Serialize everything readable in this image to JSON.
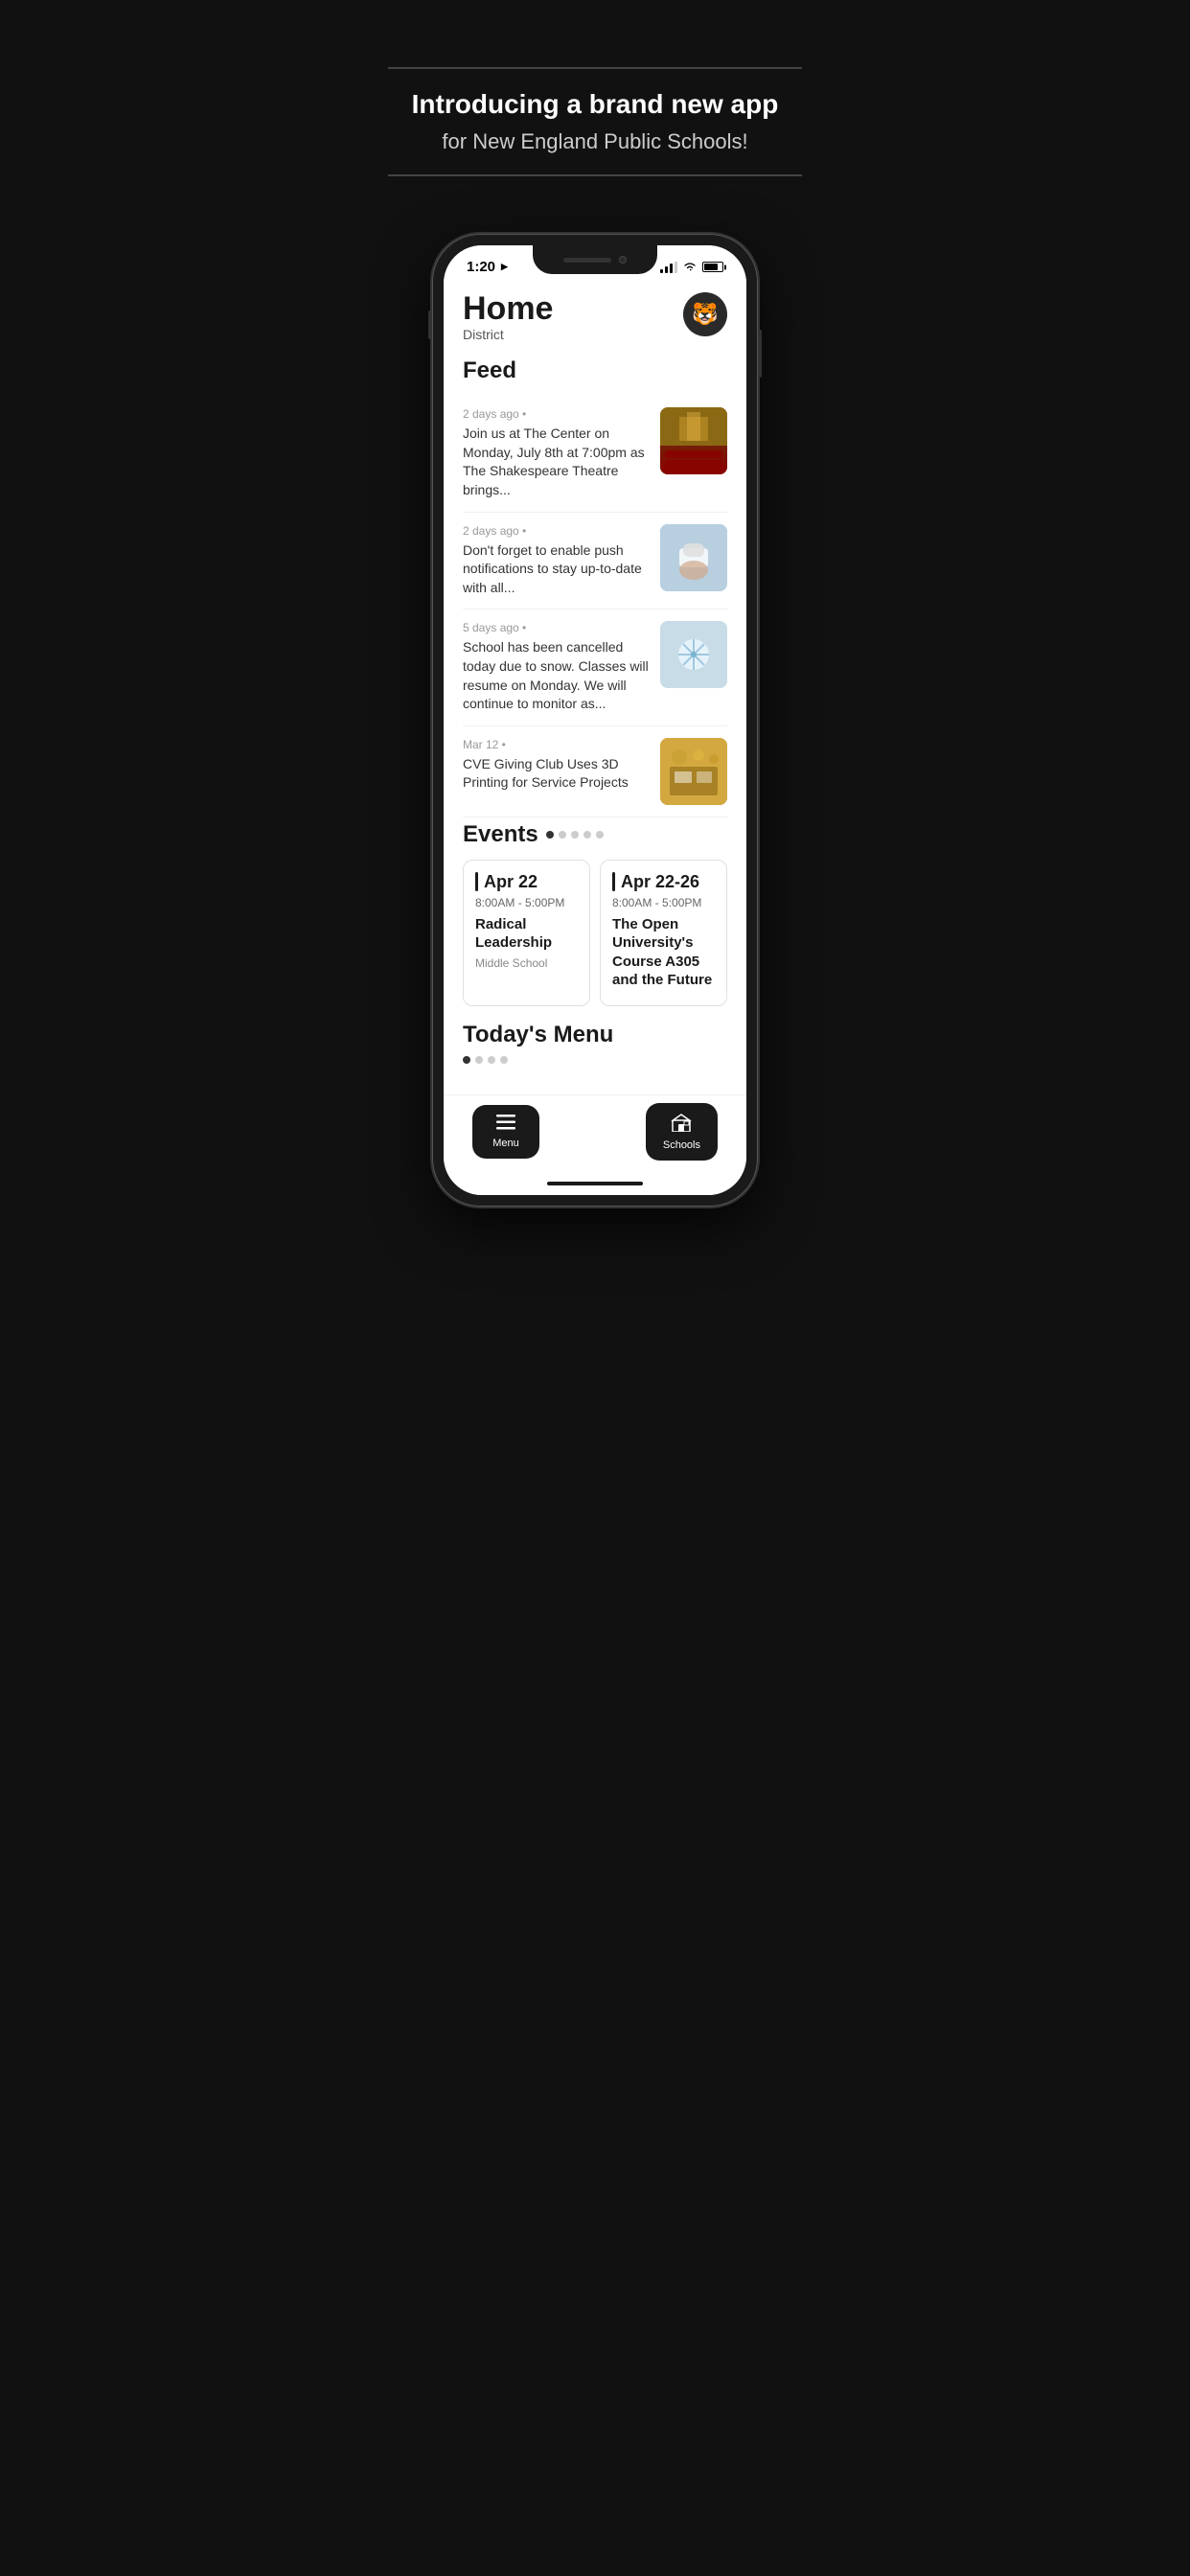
{
  "promo": {
    "divider_top": "",
    "title": "Introducing a brand new app",
    "subtitle": "for New England Public Schools!",
    "divider_bottom": ""
  },
  "statusBar": {
    "time": "1:20",
    "timeArrow": "➤"
  },
  "header": {
    "title": "Home",
    "subtitle": "District",
    "avatar": "🐯"
  },
  "feed": {
    "sectionTitle": "Feed",
    "items": [
      {
        "meta": "2 days ago • ",
        "desc": "Join us at The Center on Monday, July 8th at 7:00pm as The Shakespeare Theatre brings...",
        "thumbType": "theater"
      },
      {
        "meta": "2 days ago • ",
        "desc": "Don't forget to enable push notifications to stay up-to-date with all...",
        "thumbType": "phone"
      },
      {
        "meta": "5 days ago • ",
        "desc": "School has been cancelled today due to snow. Classes will resume on Monday. We will continue to monitor as...",
        "thumbType": "snow"
      },
      {
        "meta": "Mar 12 • ",
        "desc": "CVE Giving Club Uses 3D Printing for Service Projects",
        "thumbType": "3d"
      }
    ]
  },
  "events": {
    "sectionTitle": "Events",
    "dots": [
      {
        "active": true
      },
      {
        "active": false
      },
      {
        "active": false
      },
      {
        "active": false
      },
      {
        "active": false
      }
    ],
    "cards": [
      {
        "date": "Apr 22",
        "time": "8:00AM  -  5:00PM",
        "name": "Radical Leadership",
        "location": "Middle School"
      },
      {
        "date": "Apr 22-26",
        "time": "8:00AM  -  5:00PM",
        "name": "The Open University's Course A305 and the Future",
        "location": ""
      }
    ]
  },
  "menu": {
    "sectionTitle": "Today's Menu",
    "dots": [
      {
        "active": true
      },
      {
        "active": false
      },
      {
        "active": false
      },
      {
        "active": false
      }
    ]
  },
  "bottomNav": {
    "menuLabel": "Menu",
    "schoolsLabel": "Schools"
  }
}
